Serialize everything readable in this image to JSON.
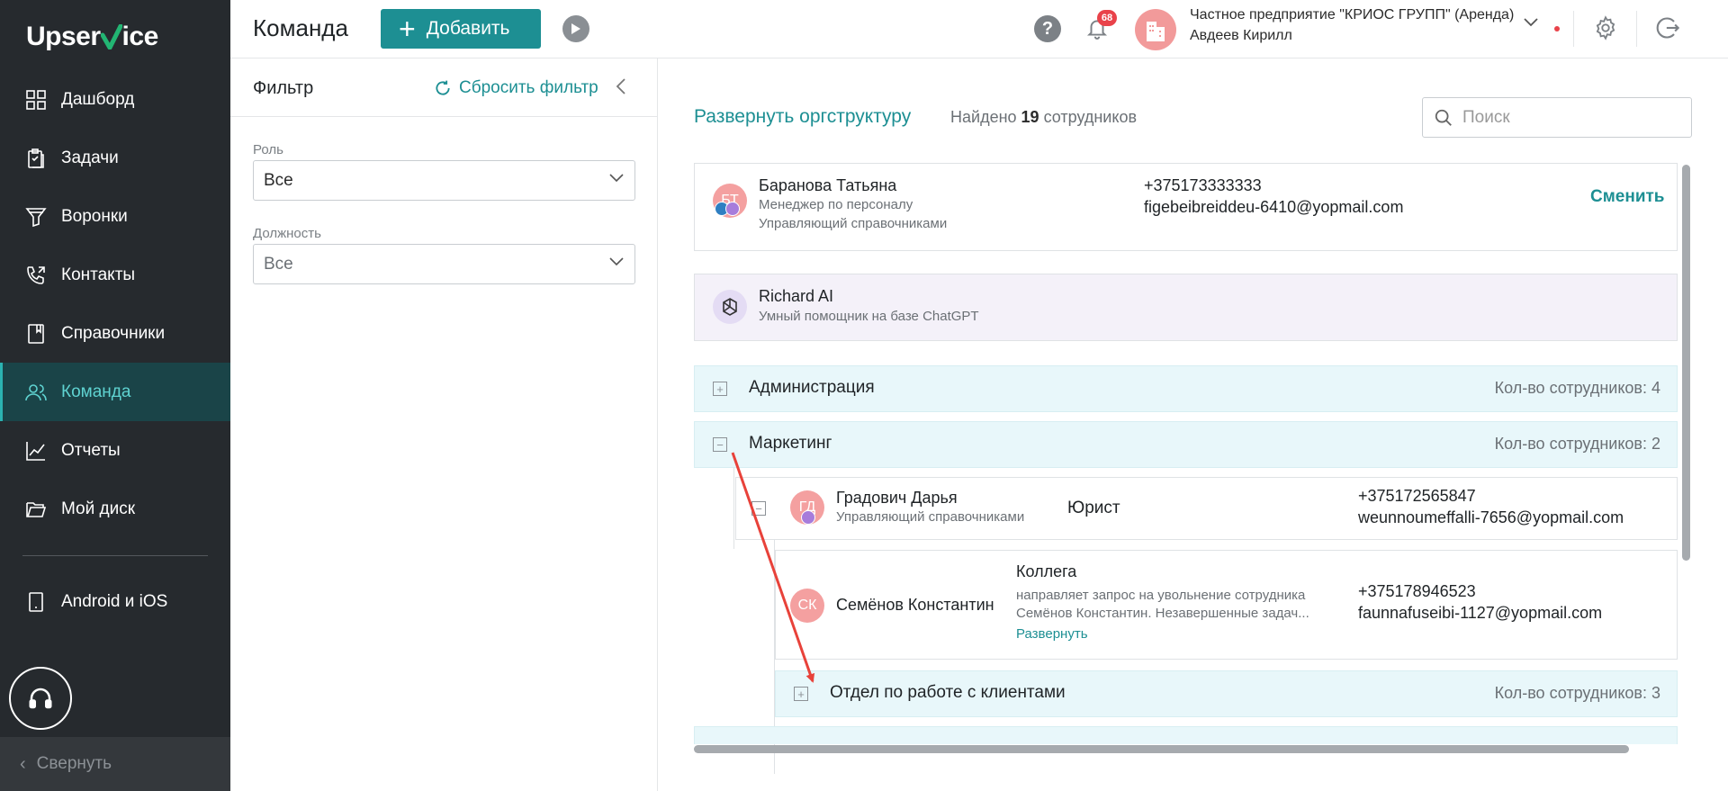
{
  "sidebar": {
    "logo_left": "Upser",
    "logo_right": "ice",
    "items": [
      {
        "label": "Дашборд",
        "icon": "dashboard-icon"
      },
      {
        "label": "Задачи",
        "icon": "tasks-icon"
      },
      {
        "label": "Воронки",
        "icon": "funnel-icon"
      },
      {
        "label": "Контакты",
        "icon": "contacts-icon"
      },
      {
        "label": "Справочники",
        "icon": "book-icon"
      },
      {
        "label": "Команда",
        "icon": "team-icon",
        "active": true
      },
      {
        "label": "Отчеты",
        "icon": "chart-icon"
      },
      {
        "label": "Мой диск",
        "icon": "folder-icon"
      },
      {
        "label": "Android и iOS",
        "icon": "tablet-icon"
      }
    ],
    "collapse_label": "Свернуть"
  },
  "topbar": {
    "title": "Команда",
    "add_label": "Добавить",
    "notifications_count": "68",
    "org_name": "Частное предприятие \"КРИОС ГРУПП\" (Аренда)",
    "user_name": "Авдеев Кирилл"
  },
  "filter": {
    "title": "Фильтр",
    "reset_label": "Сбросить фильтр",
    "role_label": "Роль",
    "role_value": "Все",
    "position_label": "Должность",
    "position_value": "Все"
  },
  "main": {
    "expand_org_label": "Развернуть оргструктуру",
    "found_prefix": "Найдено",
    "found_count": "19",
    "found_suffix": "сотрудников",
    "search_placeholder": "Поиск",
    "owner": {
      "initials": "БТ",
      "name": "Баранова Татьяна",
      "role": "Менеджер по персоналу",
      "subrole": "Управляющий справочниками",
      "phone": "+375173333333",
      "email": "figebeibreiddeu-6410@yopmail.com",
      "change_label": "Сменить"
    },
    "ai": {
      "name": "Richard AI",
      "desc": "Умный помощник на базе ChatGPT"
    },
    "departments": [
      {
        "name": "Администрация",
        "count": "Кол-во сотрудников: 4"
      },
      {
        "name": "Маркетинг",
        "count": "Кол-во сотрудников: 2"
      }
    ],
    "head": {
      "initials": "ГД",
      "name": "Градович Дарья",
      "subrole": "Управляющий справочниками",
      "position": "Юрист",
      "phone": "+375172565847",
      "email": "weunnoumeffalli-7656@yopmail.com"
    },
    "member": {
      "initials": "СК",
      "name": "Семёнов Константин",
      "position": "Коллега",
      "desc1": "направляет запрос на увольнение сотрудника",
      "desc2": "Семёнов Константин. Незавершенные задач...",
      "expand_label": "Развернуть",
      "phone": "+375178946523",
      "email": "faunnafuseibi-1127@yopmail.com"
    },
    "subdept": {
      "name": "Отдел по работе с клиентами",
      "count": "Кол-во сотрудников: 3"
    }
  },
  "colors": {
    "accent": "#1d8f93",
    "sidebar_bg": "#262a2e",
    "active_bg": "#1a4448",
    "dept_bg": "#e8f7fa",
    "ai_bg": "#f4f1f9",
    "avatar": "#f4a0a0",
    "arrow": "#e8423a"
  }
}
